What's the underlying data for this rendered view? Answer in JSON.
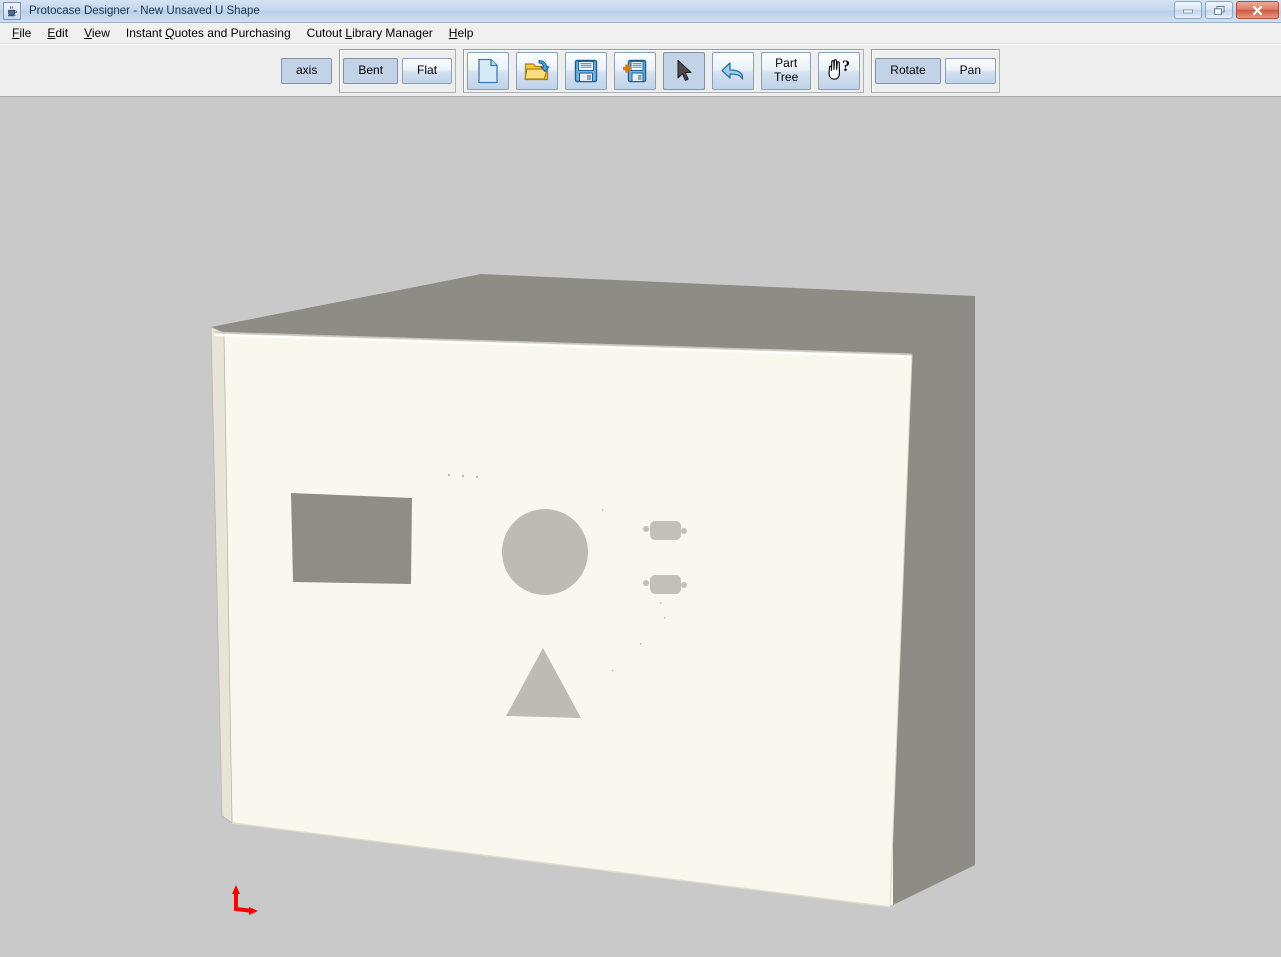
{
  "window": {
    "title": "Protocase Designer - New Unsaved U Shape",
    "app_icon": "java-coffee-cup-icon",
    "controls": [
      {
        "name": "minimize-button",
        "glyph": "minimize-icon"
      },
      {
        "name": "restore-button",
        "glyph": "restore-icon"
      },
      {
        "name": "close-button",
        "glyph": "close-icon"
      }
    ]
  },
  "menubar": {
    "items": [
      {
        "label": "File",
        "mnemonic": "F",
        "name": "menu-file"
      },
      {
        "label": "Edit",
        "mnemonic": "E",
        "name": "menu-edit"
      },
      {
        "label": "View",
        "mnemonic": "V",
        "name": "menu-view"
      },
      {
        "label": "Instant Quotes and Purchasing",
        "mnemonic": "Q",
        "name": "menu-instant-quotes-and-purchasing"
      },
      {
        "label": "Cutout Library Manager",
        "mnemonic": "L",
        "name": "menu-cutout-library-manager"
      },
      {
        "label": "Help",
        "mnemonic": "H",
        "name": "menu-help"
      }
    ]
  },
  "toolbar": {
    "axis_label": "axis",
    "axis_selected": true,
    "bent_label": "Bent",
    "bent_selected": true,
    "flat_label": "Flat",
    "flat_selected": false,
    "new_icon": "new-document-icon",
    "open_icon": "open-folder-icon",
    "save_icon": "save-floppy-icon",
    "save_as_icon": "save-as-floppy-plus-icon",
    "select_icon": "select-arrow-cursor-icon",
    "undo_icon": "undo-arrow-icon",
    "part_tree_line1": "Part",
    "part_tree_line2": "Tree",
    "help_cursor_icon": "hand-question-help-icon",
    "rotate_label": "Rotate",
    "rotate_selected": true,
    "pan_label": "Pan",
    "pan_selected": false
  },
  "viewport": {
    "background_color": "#c9c9c9",
    "model_name": "u-shape-enclosure",
    "face_front_color": "#faf8ee",
    "face_top_color": "#8d8d86",
    "face_right_color": "#8d8d86",
    "cutout_color": "#bdbbb2",
    "axis_color": "#ff0000",
    "cutouts": [
      {
        "name": "cutout-rectangle",
        "shape": "rectangle"
      },
      {
        "name": "cutout-circle",
        "shape": "circle"
      },
      {
        "name": "cutout-dsub-top",
        "shape": "d-sub-connector"
      },
      {
        "name": "cutout-dsub-bottom",
        "shape": "d-sub-connector"
      },
      {
        "name": "cutout-triangle",
        "shape": "triangle"
      }
    ],
    "axis_indicator": "origin-axis-indicator"
  }
}
